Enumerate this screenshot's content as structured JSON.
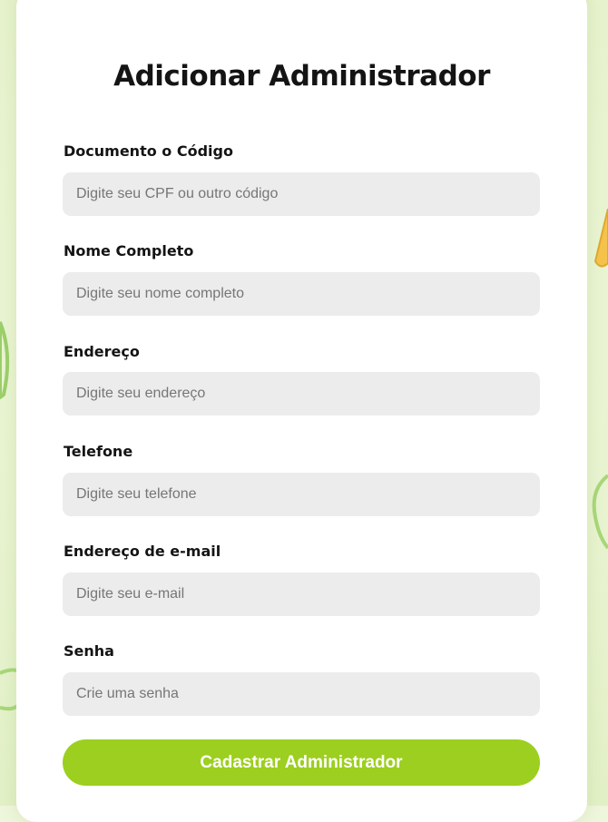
{
  "form": {
    "title": "Adicionar Administrador",
    "fields": [
      {
        "label": "Documento o Código",
        "placeholder": "Digite seu CPF ou outro código"
      },
      {
        "label": "Nome Completo",
        "placeholder": "Digite seu nome completo"
      },
      {
        "label": "Endereço",
        "placeholder": "Digite seu endereço"
      },
      {
        "label": "Telefone",
        "placeholder": "Digite seu telefone"
      },
      {
        "label": "Endereço de e-mail",
        "placeholder": "Digite seu e-mail"
      },
      {
        "label": "Senha",
        "placeholder": "Crie uma senha"
      }
    ],
    "submit_label": "Cadastrar Administrador"
  },
  "colors": {
    "accent": "#9ccf20",
    "field_background": "#ececec",
    "page_background": "#eef6dc"
  }
}
